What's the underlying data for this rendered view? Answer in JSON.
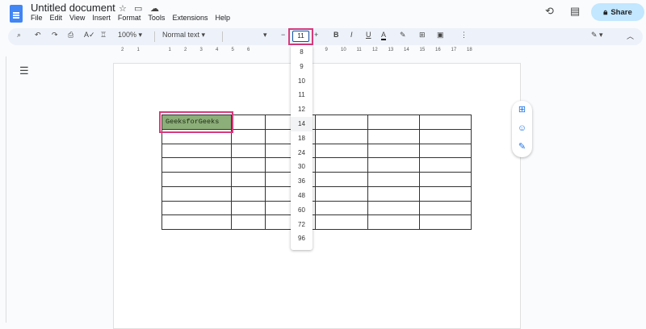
{
  "app": {
    "title": "Untitled document",
    "share_label": "Share",
    "menu": [
      "File",
      "Edit",
      "View",
      "Insert",
      "Format",
      "Tools",
      "Extensions",
      "Help"
    ]
  },
  "toolbar": {
    "zoom": "100%",
    "style": "Normal text",
    "font": "",
    "font_size": "11",
    "minus": "−",
    "plus": "+",
    "bold": "B",
    "italic": "I",
    "underline": "U",
    "text_color": "A"
  },
  "ruler": [
    "2",
    "1",
    "",
    "1",
    "2",
    "3",
    "4",
    "5",
    "6",
    "",
    "",
    "9",
    "10",
    "11",
    "12",
    "13",
    "14",
    "15",
    "16",
    "17",
    "18"
  ],
  "font_size_options": [
    "8",
    "9",
    "10",
    "11",
    "12",
    "14",
    "18",
    "24",
    "30",
    "36",
    "48",
    "60",
    "72",
    "96"
  ],
  "highlighted_option": "14",
  "table": {
    "cell_text": "GeeksforGeeks",
    "rows": 8,
    "cols": 6,
    "highlight_color": "#8cae78"
  },
  "colors": {
    "accent": "#1a73e8",
    "highlight_box": "#d63a7c",
    "share_bg": "#c2e7ff"
  }
}
